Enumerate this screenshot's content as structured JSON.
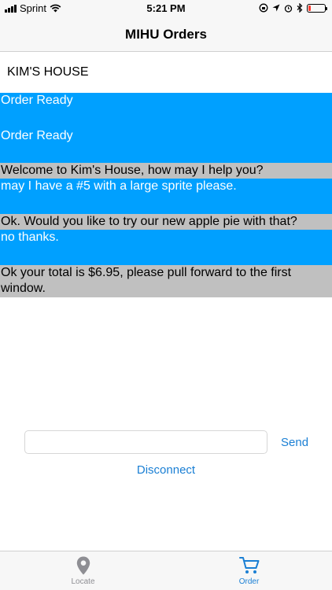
{
  "status_bar": {
    "carrier": "Sprint",
    "time": "5:21 PM",
    "battery_color": "#ff3b30",
    "battery_level": 0.15
  },
  "nav": {
    "title": "MIHU Orders"
  },
  "place": {
    "name": "KIM'S HOUSE"
  },
  "messages": [
    {
      "role": "system",
      "text": "Order Ready"
    },
    {
      "role": "system",
      "text": "Order Ready"
    },
    {
      "role": "agent",
      "text": "Welcome to Kim's House, how may I help you?"
    },
    {
      "role": "customer",
      "text": "may I have a #5 with a large sprite please."
    },
    {
      "role": "agent",
      "text": "Ok. Would you like to try our new apple pie with that?"
    },
    {
      "role": "customer",
      "text": "no thanks."
    },
    {
      "role": "agent",
      "text": "Ok your total is $6.95, please pull forward to the first window."
    }
  ],
  "input": {
    "value": "",
    "placeholder": ""
  },
  "buttons": {
    "send": "Send",
    "disconnect": "Disconnect"
  },
  "tabs": [
    {
      "label": "Locate",
      "icon": "location-pin-icon",
      "active": false
    },
    {
      "label": "Order",
      "icon": "cart-icon",
      "active": true
    }
  ],
  "colors": {
    "accent": "#1a7fd4",
    "customer_bubble": "#00a0ff",
    "agent_bubble": "#c0c0c0"
  }
}
